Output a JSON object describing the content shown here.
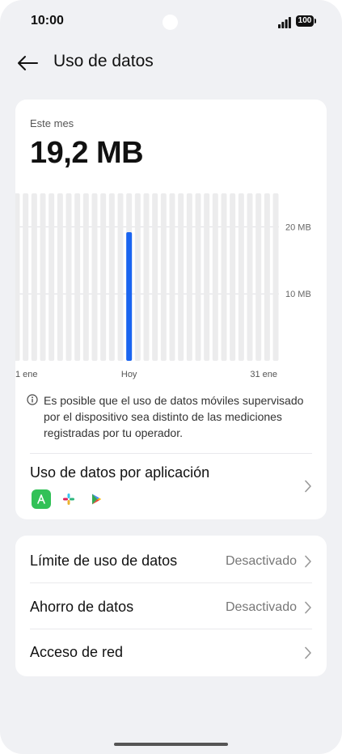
{
  "status_bar": {
    "time": "10:00",
    "battery_level": "100"
  },
  "header": {
    "title": "Uso de datos",
    "back_icon": "arrow-left-icon"
  },
  "usage": {
    "period_label": "Este mes",
    "total": "19,2 MB",
    "notice": "Es posible que el uso de datos móviles supervisado por el dispositivo sea distinto de las mediciones registradas por tu operador.",
    "info_icon": "info-icon"
  },
  "chart_data": {
    "type": "bar",
    "x_labels": [
      "1 ene",
      "Hoy",
      "31 ene"
    ],
    "y_ticks": [
      "20 MB",
      "10 MB"
    ],
    "ylim": [
      0,
      25
    ],
    "day_count": 31,
    "today_index": 13,
    "today_value": 19.2,
    "accent_color": "#1a64f0",
    "track_color": "#ececed"
  },
  "app_usage": {
    "title": "Uso de datos por aplicación",
    "icons": [
      "app-store-icon",
      "slack-icon",
      "play-store-icon"
    ]
  },
  "settings": {
    "rows": [
      {
        "label": "Límite de uso de datos",
        "value": "Desactivado"
      },
      {
        "label": "Ahorro de datos",
        "value": "Desactivado"
      },
      {
        "label": "Acceso de red",
        "value": ""
      }
    ]
  }
}
